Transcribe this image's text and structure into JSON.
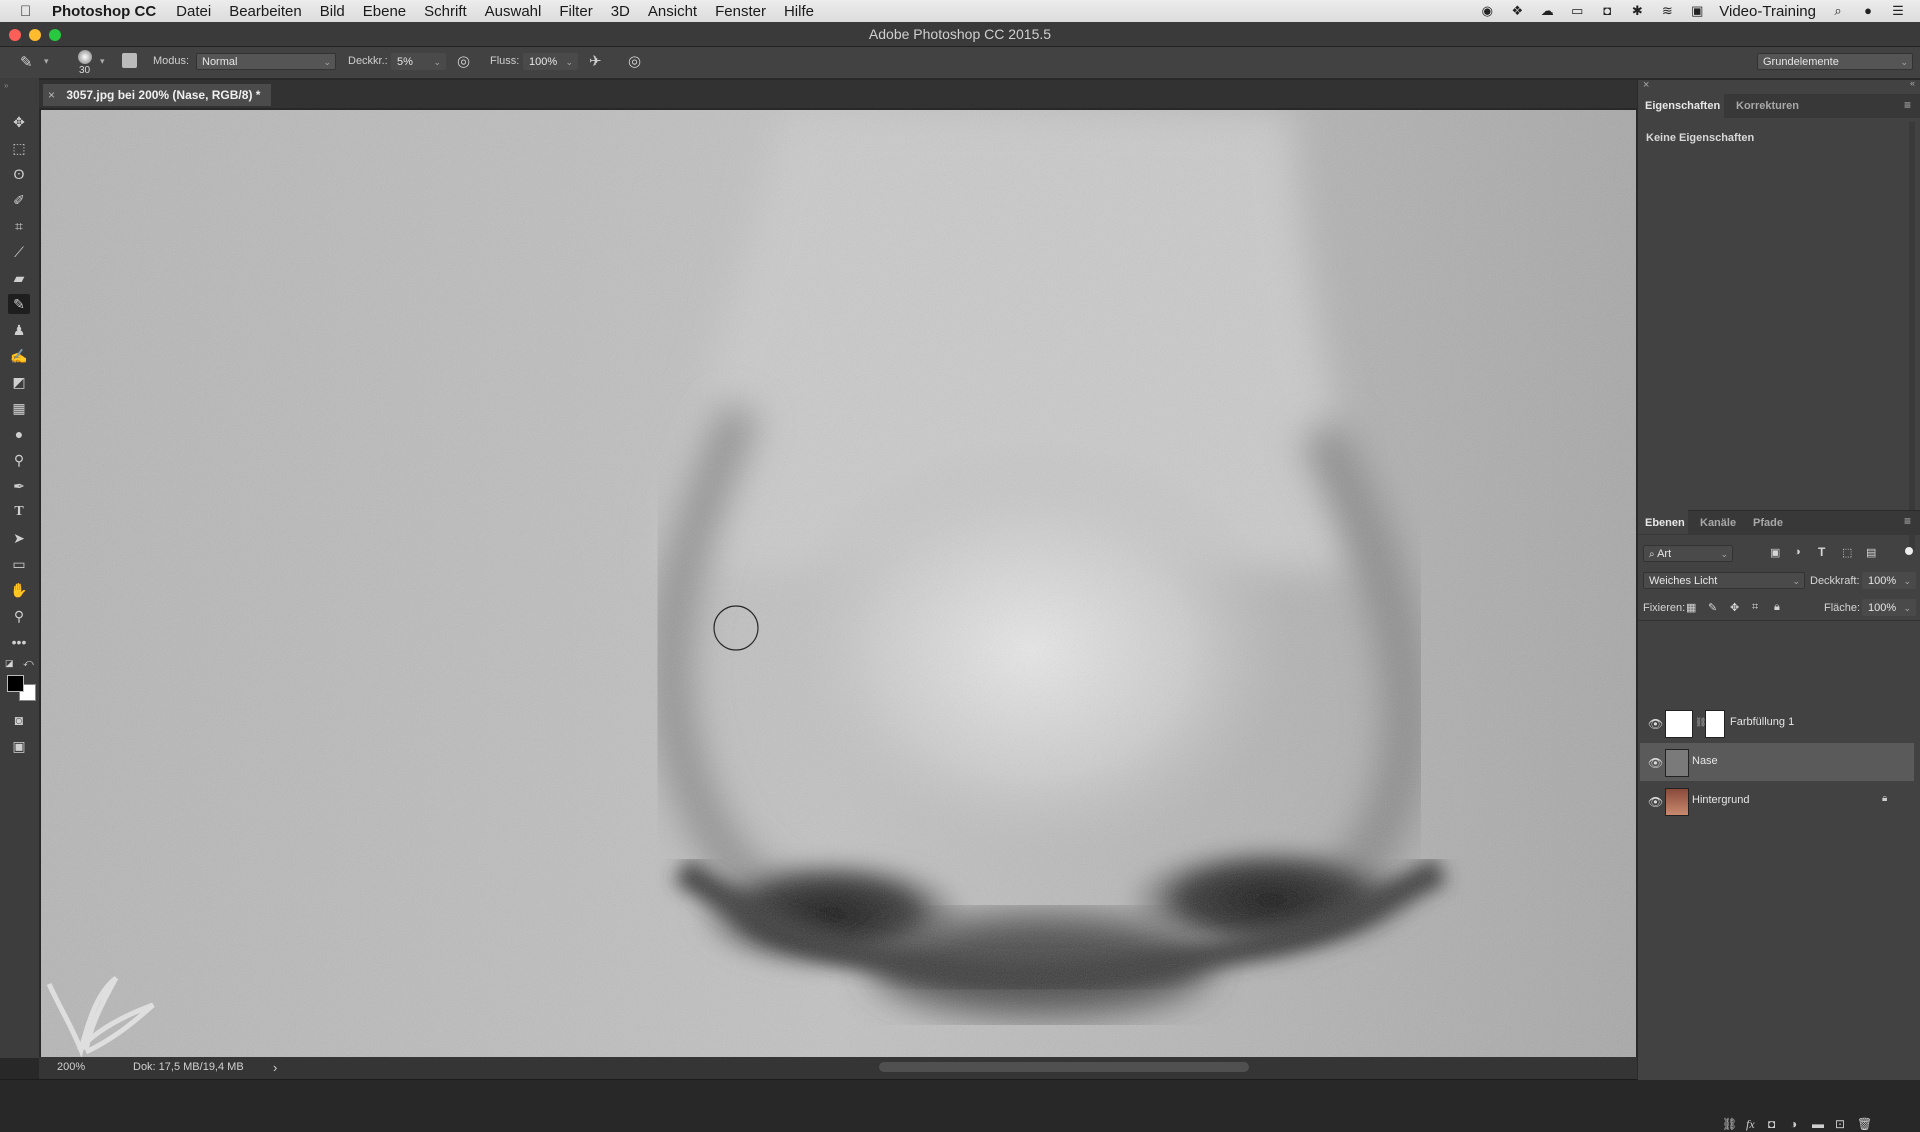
{
  "menubar": {
    "apple": "",
    "app_name": "Photoshop CC",
    "items": [
      "Datei",
      "Bearbeiten",
      "Bild",
      "Ebene",
      "Schrift",
      "Auswahl",
      "Filter",
      "3D",
      "Ansicht",
      "Fenster",
      "Hilfe"
    ],
    "right_label": "Video-Training"
  },
  "window": {
    "title": "Adobe Photoshop CC 2015.5"
  },
  "options_bar": {
    "brush_size": "30",
    "mode_label": "Modus:",
    "mode_value": "Normal",
    "opacity_label": "Deckkr.:",
    "opacity_value": "5%",
    "flow_label": "Fluss:",
    "flow_value": "100%",
    "workspace": "Grundelemente"
  },
  "document_tab": {
    "close": "×",
    "label": "3057.jpg bei 200% (Nase, RGB/8) *"
  },
  "status_bar": {
    "zoom": "200%",
    "doc_info": "Dok: 17,5 MB/19,4 MB",
    "arrow": "›"
  },
  "properties_panel": {
    "tabs": [
      "Eigenschaften",
      "Korrekturen"
    ],
    "empty_text": "Keine Eigenschaften"
  },
  "layers_panel": {
    "tabs": [
      "Ebenen",
      "Kanäle",
      "Pfade"
    ],
    "filter_label": "Art",
    "blend_mode": "Weiches Licht",
    "opacity_label": "Deckkraft:",
    "opacity_value": "100%",
    "lock_label": "Fixieren:",
    "fill_label": "Fläche:",
    "fill_value": "100%",
    "layers": [
      {
        "name": "Farbfüllung 1"
      },
      {
        "name": "Nase"
      },
      {
        "name": "Hintergrund"
      }
    ]
  },
  "colors": {
    "accent_selected_layer": "#5a5a5a",
    "foreground_color": "#000000",
    "background_color": "#ffffff"
  }
}
